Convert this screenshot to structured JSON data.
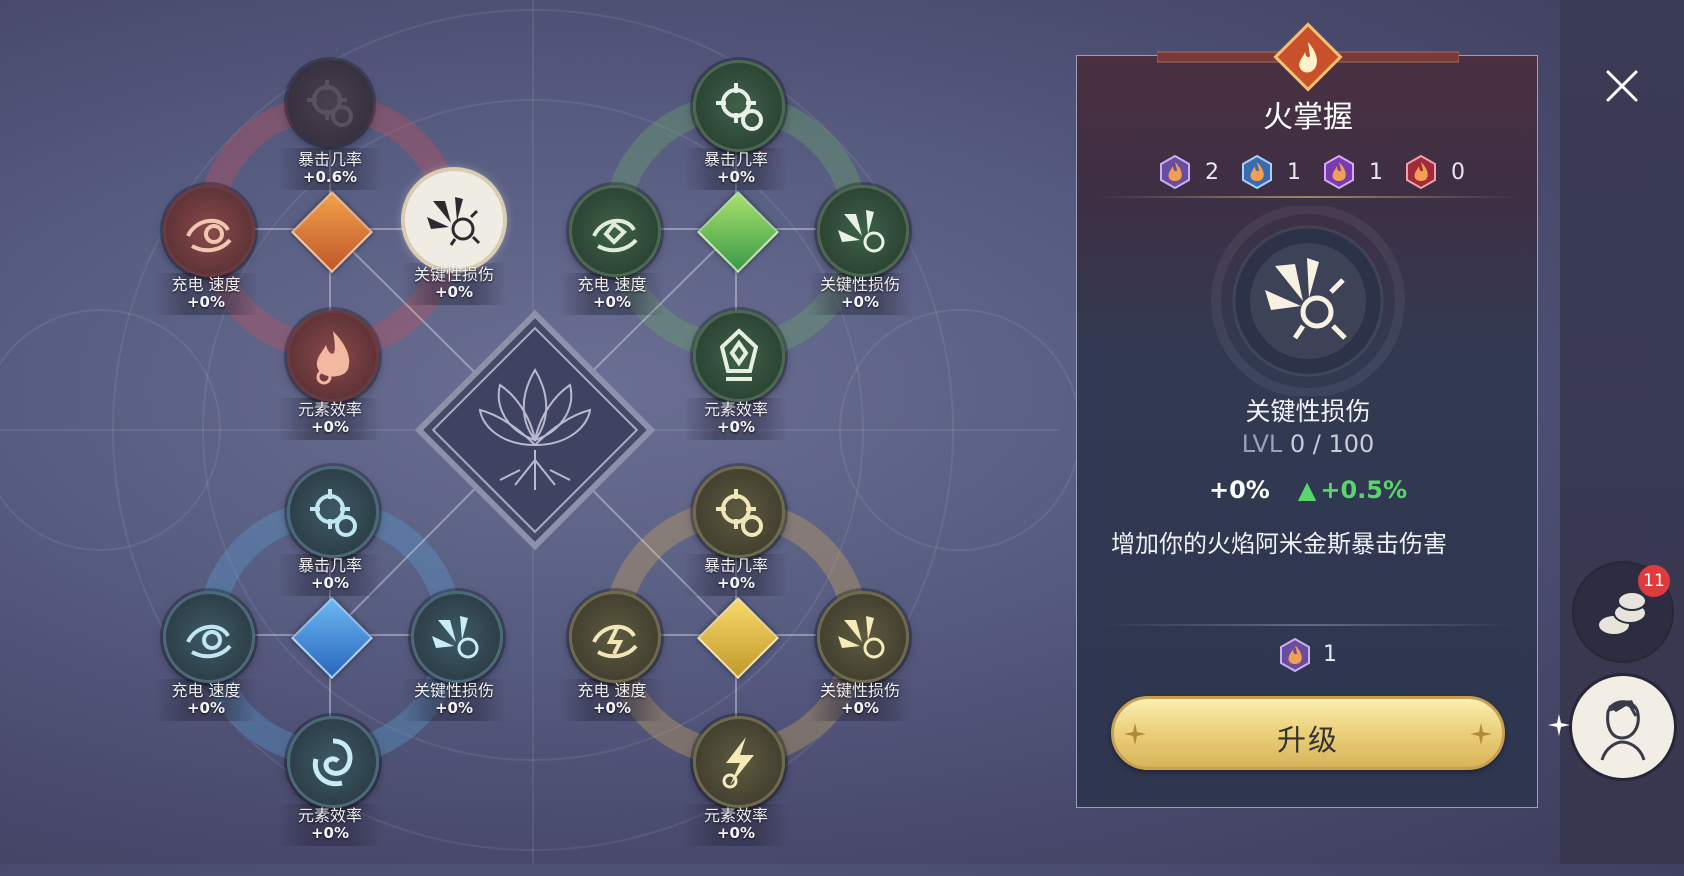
{
  "tree": {
    "red": {
      "top": {
        "label": "暴击几率",
        "value": "+0.6%"
      },
      "left": {
        "label": "充电 速度",
        "value": "+0%"
      },
      "right": {
        "label": "关键性损伤",
        "value": "+0%"
      },
      "bottom": {
        "label": "元素效率",
        "value": "+0%"
      }
    },
    "green": {
      "top": {
        "label": "暴击几率",
        "value": "+0%"
      },
      "left": {
        "label": "充电 速度",
        "value": "+0%"
      },
      "right": {
        "label": "关键性损伤",
        "value": "+0%"
      },
      "bottom": {
        "label": "元素效率",
        "value": "+0%"
      }
    },
    "blue": {
      "top": {
        "label": "暴击几率",
        "value": "+0%"
      },
      "left": {
        "label": "充电 速度",
        "value": "+0%"
      },
      "right": {
        "label": "关键性损伤",
        "value": "+0%"
      },
      "bottom": {
        "label": "元素效率",
        "value": "+0%"
      }
    },
    "gold": {
      "top": {
        "label": "暴击几率",
        "value": "+0%"
      },
      "left": {
        "label": "充电 速度",
        "value": "+0%"
      },
      "right": {
        "label": "关键性损伤",
        "value": "+0%"
      },
      "bottom": {
        "label": "元素效率",
        "value": "+0%"
      }
    }
  },
  "panel": {
    "title": "火掌握",
    "resources": [
      {
        "icon": "orange-fire-gem-icon",
        "count": "2"
      },
      {
        "icon": "blue-fire-gem-icon",
        "count": "1"
      },
      {
        "icon": "purple-fire-gem-icon",
        "count": "1"
      },
      {
        "icon": "red-fire-gem-icon",
        "count": "0"
      }
    ],
    "skill_name": "关键性损伤",
    "level_prefix": "LVL",
    "level_value": "0 / 100",
    "stat_current": "+0%",
    "stat_next": "+0.5%",
    "description": "增加你的火焰阿米金斯暴击伤害",
    "cost": "1",
    "upgrade_label": "升级"
  },
  "sidebar": {
    "coins_badge": "11"
  },
  "colors": {
    "red": "#c55a5a",
    "green": "#6aa66a",
    "blue": "#5aa6d8",
    "gold": "#d8b45a",
    "accent_green": "#59d66a"
  }
}
